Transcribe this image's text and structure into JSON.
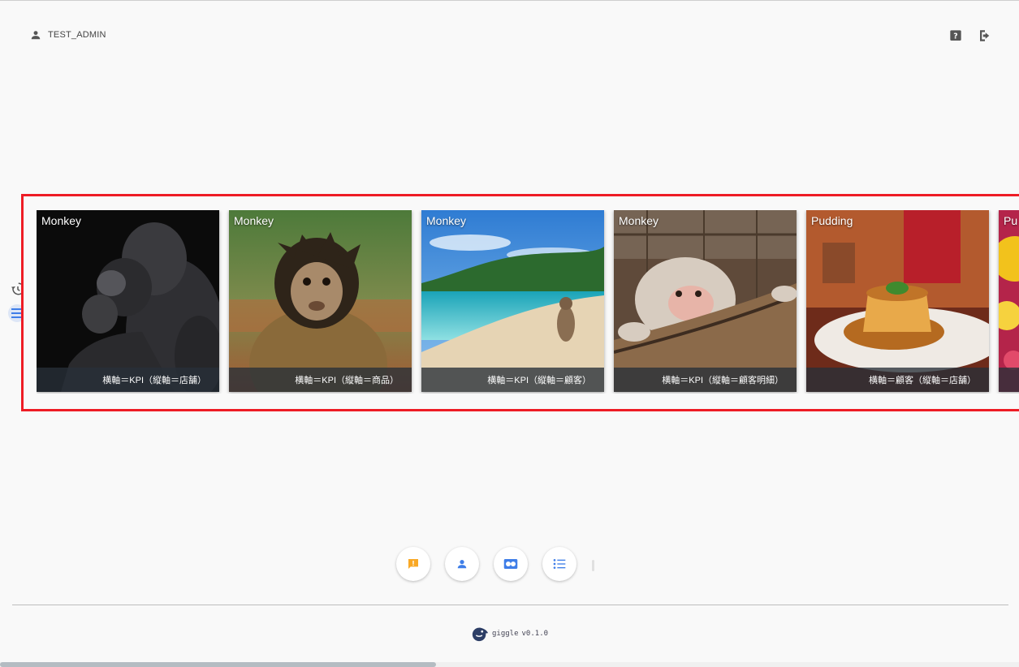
{
  "header": {
    "username": "TEST_ADMIN",
    "icons": [
      "person-icon",
      "help-icon",
      "logout-icon"
    ]
  },
  "side": {
    "icons": [
      "history-icon",
      "menu-icon"
    ]
  },
  "cards": [
    {
      "title": "Monkey",
      "caption": "横軸＝KPI（縦軸＝店舗）"
    },
    {
      "title": "Monkey",
      "caption": "横軸＝KPI（縦軸＝商品）"
    },
    {
      "title": "Monkey",
      "caption": "横軸＝KPI（縦軸＝顧客）"
    },
    {
      "title": "Monkey",
      "caption": "横軸＝KPI（縦軸＝顧客明細）"
    },
    {
      "title": "Pudding",
      "caption": "横軸＝顧客（縦軸＝店舗）"
    },
    {
      "title": "Pu",
      "caption": ""
    }
  ],
  "actions": {
    "icons": [
      "alert-comment-icon",
      "person-icon",
      "card-view-icon",
      "list-icon"
    ],
    "colors": {
      "alert": "#f9a825",
      "primary": "#3f7ee8"
    }
  },
  "footer": {
    "app": "giggle",
    "version": "v0.1.0"
  },
  "colors": {
    "highlight": "#ee1c25",
    "background": "#f9f9f9"
  }
}
